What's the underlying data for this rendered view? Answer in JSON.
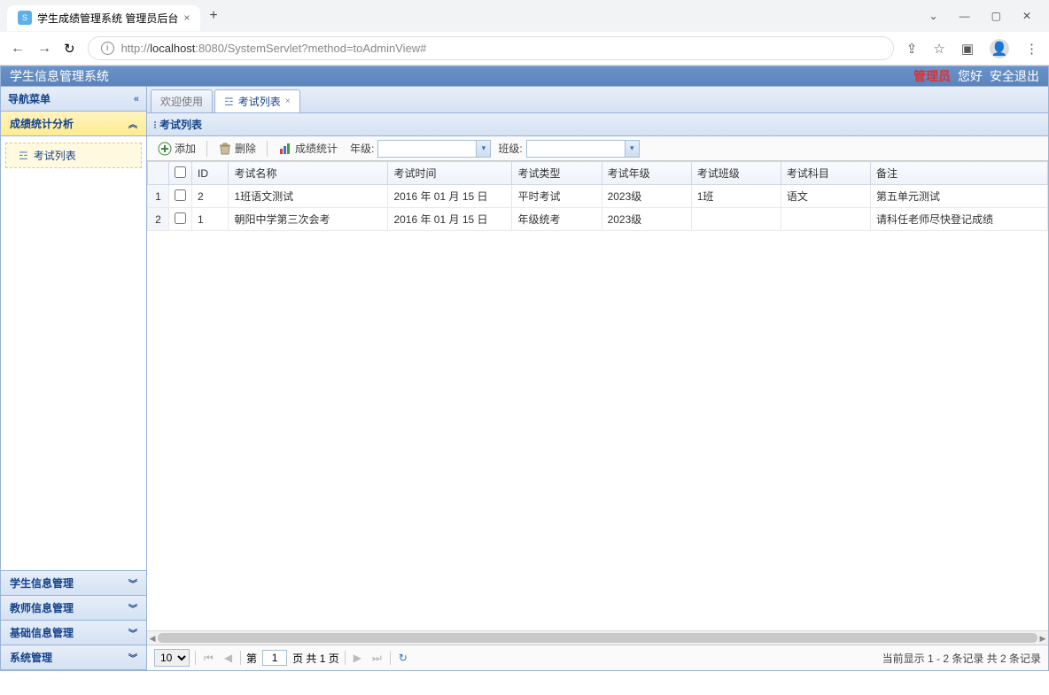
{
  "browser": {
    "tab_title": "学生成绩管理系统 管理员后台",
    "new_tab": "+",
    "url_prefix": "http://",
    "url_host": "localhost",
    "url_path": ":8080/SystemServlet?method=toAdminView#"
  },
  "header": {
    "title": "学生信息管理系统",
    "role": "管理员",
    "greeting": "您好",
    "logout": "安全退出"
  },
  "sidebar": {
    "title": "导航菜单",
    "sections": [
      {
        "label": "成绩统计分析",
        "active": true
      },
      {
        "label": "学生信息管理"
      },
      {
        "label": "教师信息管理"
      },
      {
        "label": "基础信息管理"
      },
      {
        "label": "系统管理"
      }
    ],
    "tree_item": "考试列表"
  },
  "tabs": {
    "inactive": "欢迎使用",
    "active": "考试列表"
  },
  "panel_title": "考试列表",
  "toolbar": {
    "add": "添加",
    "delete": "删除",
    "stats": "成绩统计",
    "grade_label": "年级:",
    "class_label": "班级:"
  },
  "columns": [
    "ID",
    "考试名称",
    "考试时间",
    "考试类型",
    "考试年级",
    "考试班级",
    "考试科目",
    "备注"
  ],
  "rows": [
    {
      "n": "1",
      "id": "2",
      "name": "1班语文测试",
      "time": "2016 年 01 月 15 日",
      "type": "平时考试",
      "grade": "2023级",
      "class": "1班",
      "subject": "语文",
      "remark": "第五单元测试"
    },
    {
      "n": "2",
      "id": "1",
      "name": "朝阳中学第三次会考",
      "time": "2016 年 01 月 15 日",
      "type": "年级统考",
      "grade": "2023级",
      "class": "",
      "subject": "",
      "remark": "请科任老师尽快登记成绩"
    }
  ],
  "pager": {
    "size": "10",
    "page_prefix": "第",
    "page": "1",
    "page_suffix": "页 共 1 页",
    "info": "当前显示 1 - 2 条记录 共 2 条记录"
  }
}
